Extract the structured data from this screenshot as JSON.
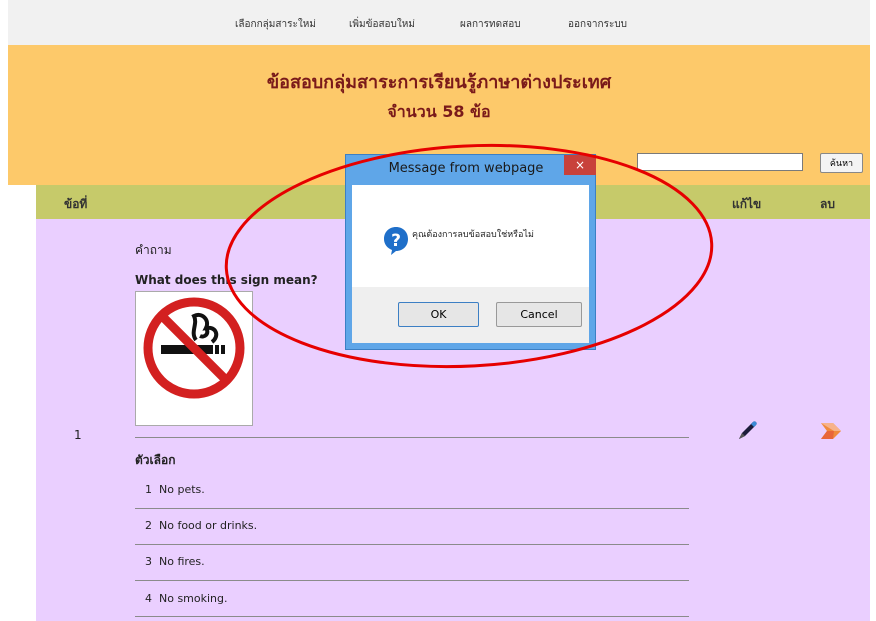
{
  "nav": {
    "items": [
      "เลือกกลุ่มสาระใหม่",
      "เพิ่มข้อสอบใหม่",
      "ผลการทดสอบ",
      "ออกจากระบบ"
    ]
  },
  "header": {
    "title": "ข้อสอบกลุ่มสาระการเรียนรู้ภาษาต่างประเทศ",
    "count_prefix": "จำนวน",
    "count": "58",
    "count_suffix": "ข้อ"
  },
  "search": {
    "value": "",
    "button_label": "ค้นหา"
  },
  "table": {
    "headers": {
      "number": "ข้อที่",
      "edit": "แก้ไข",
      "delete": "ลบ"
    },
    "rows": [
      {
        "number": "1",
        "question_label": "คำถาม",
        "question_text": "What does this sign mean?",
        "choices_label": "ตัวเลือก",
        "choices": [
          {
            "num": "1",
            "text": "No pets."
          },
          {
            "num": "2",
            "text": "No food or drinks."
          },
          {
            "num": "3",
            "text": "No fires."
          },
          {
            "num": "4",
            "text": "No smoking."
          }
        ]
      }
    ]
  },
  "dialog": {
    "title": "Message from webpage",
    "close_label": "×",
    "message": "คุณต้องการลบข้อสอบใช่หรือไม่",
    "ok_label": "OK",
    "cancel_label": "Cancel"
  },
  "colors": {
    "header_bg": "#fdc96a",
    "title_text": "#7a1a1a",
    "table_header_bg": "#c6ca6a",
    "table_body_bg": "#eacfff",
    "dialog_frame": "#5fa6e8",
    "highlight_ellipse": "#e60000"
  }
}
